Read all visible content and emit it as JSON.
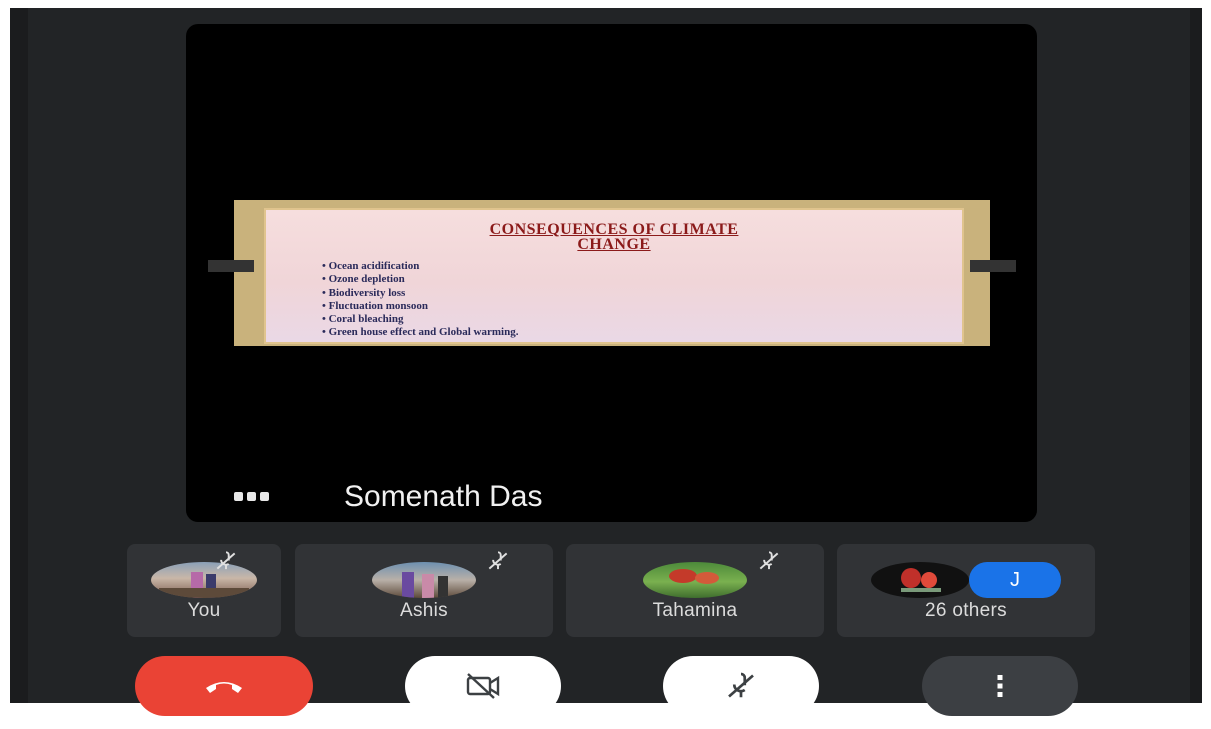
{
  "presenter": {
    "name": "Somenath Das"
  },
  "slide": {
    "title_line1": "CONSEQUENCES OF CLIMATE",
    "title_line2": "CHANGE",
    "bullets": [
      "Ocean acidification",
      "Ozone depletion",
      "Biodiversity loss",
      "Fluctuation monsoon",
      "Coral bleaching",
      "Green house effect and Global warming."
    ]
  },
  "participants": [
    {
      "label": "You"
    },
    {
      "label": "Ashis"
    },
    {
      "label": "Tahamina"
    },
    {
      "label": "26 others",
      "badge": "J"
    }
  ],
  "controls": [
    {
      "name": "end-call",
      "icon": "phone-hangup-icon",
      "color": "#ea4335"
    },
    {
      "name": "camera-toggle",
      "icon": "camera-off-icon",
      "color": "#ffffff"
    },
    {
      "name": "mic-toggle",
      "icon": "mic-off-icon",
      "color": "#ffffff"
    },
    {
      "name": "more-options",
      "icon": "more-vertical-icon",
      "color": "#3c3f43"
    }
  ],
  "colors": {
    "background": "#222426",
    "tile": "#313336",
    "accent_blue": "#1a73e8",
    "end_call_red": "#ea4335"
  }
}
